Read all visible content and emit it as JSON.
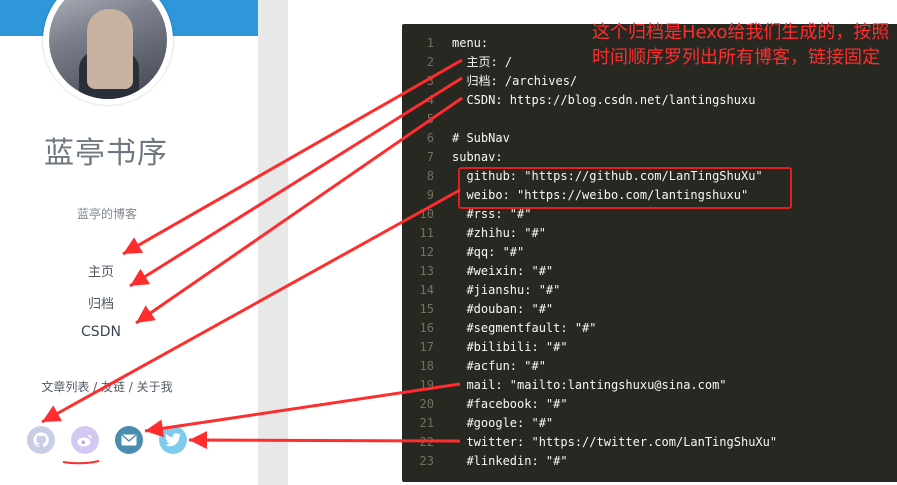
{
  "sidebar": {
    "title": "蓝亭书序",
    "subtitle": "蓝亭的博客",
    "menu": [
      {
        "label": "主页"
      },
      {
        "label": "归档"
      },
      {
        "label": "CSDN"
      }
    ],
    "links_row": "文章列表 / 友链 / 关于我",
    "social": [
      {
        "icon": "github-icon",
        "color": "#c9cde6"
      },
      {
        "icon": "weibo-icon",
        "color": "#d3c8f2"
      },
      {
        "icon": "mail-icon",
        "color": "#4a8db0"
      },
      {
        "icon": "twitter-icon",
        "color": "#7ecbee"
      }
    ]
  },
  "code": {
    "lines": [
      {
        "n": "1",
        "text": "menu:"
      },
      {
        "n": "2",
        "text": "  主页: /"
      },
      {
        "n": "3",
        "text": "  归档: /archives/"
      },
      {
        "n": "4",
        "text": "  CSDN: https://blog.csdn.net/lantingshuxu"
      },
      {
        "n": "5",
        "text": ""
      },
      {
        "n": "6",
        "text": "# SubNav"
      },
      {
        "n": "7",
        "text": "subnav:"
      },
      {
        "n": "8",
        "text": "  github: \"https://github.com/LanTingShuXu\""
      },
      {
        "n": "9",
        "text": "  weibo: \"https://weibo.com/lantingshuxu\""
      },
      {
        "n": "10",
        "text": "  #rss: \"#\""
      },
      {
        "n": "11",
        "text": "  #zhihu: \"#\""
      },
      {
        "n": "12",
        "text": "  #qq: \"#\""
      },
      {
        "n": "13",
        "text": "  #weixin: \"#\""
      },
      {
        "n": "14",
        "text": "  #jianshu: \"#\""
      },
      {
        "n": "15",
        "text": "  #douban: \"#\""
      },
      {
        "n": "16",
        "text": "  #segmentfault: \"#\""
      },
      {
        "n": "17",
        "text": "  #bilibili: \"#\""
      },
      {
        "n": "18",
        "text": "  #acfun: \"#\""
      },
      {
        "n": "19",
        "text": "  mail: \"mailto:lantingshuxu@sina.com\""
      },
      {
        "n": "20",
        "text": "  #facebook: \"#\""
      },
      {
        "n": "21",
        "text": "  #google: \"#\""
      },
      {
        "n": "22",
        "text": "  twitter: \"https://twitter.com/LanTingShuXu\""
      },
      {
        "n": "23",
        "text": "  #linkedin: \"#\""
      }
    ]
  },
  "annotation": {
    "note": "这个归档是Hexo给我们生成的，按照时间顺序罗列出所有博客，链接固定",
    "color": "#ff2d2d"
  }
}
